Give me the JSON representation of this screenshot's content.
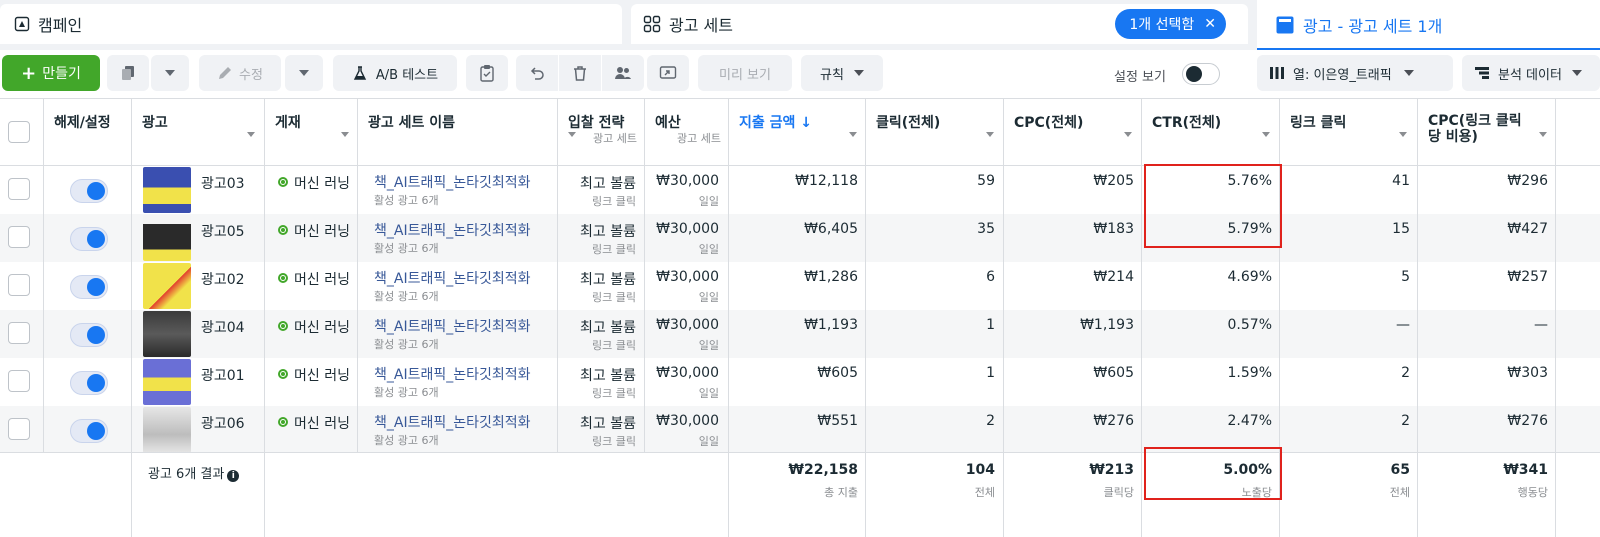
{
  "tabs": {
    "campaign": "캠페인",
    "adset": "광고 세트",
    "selected_chip": "1개 선택함",
    "ads": "광고 - 광고 세트 1개"
  },
  "toolbar": {
    "create": "만들기",
    "edit": "수정",
    "ab_test": "A/B 테스트",
    "preview": "미리 보기",
    "rules": "규칙",
    "view_settings": "설정 보기",
    "columns": "열: 이은영_트래픽",
    "breakdown": "분석 데이터"
  },
  "columns": {
    "toggle": "해제/설정",
    "ad": "광고",
    "delivery": "게재",
    "adset_name": "광고 세트 이름",
    "bid": "입찰 전략",
    "bid_sub": "광고 세트",
    "budget": "예산",
    "budget_sub": "광고 세트",
    "spend": "지출 금액 ↓",
    "clicks": "클릭(전체)",
    "cpc": "CPC(전체)",
    "ctr": "CTR(전체)",
    "link_clicks": "링크 클릭",
    "cpc_link": "CPC(링크 클릭 당 비용)"
  },
  "rows": [
    {
      "name": "광고03",
      "status": "머신 러닝",
      "adset": "책_AI트래픽_논타깃최적화",
      "adset_sub": "활성 광고 6개",
      "bid": "최고 볼륨",
      "bid_sub": "링크 클릭",
      "budget": "₩30,000",
      "budget_sub": "일일",
      "spend": "₩12,118",
      "clicks": "59",
      "cpc": "₩205",
      "ctr": "5.76%",
      "link_clicks": "41",
      "cpc_link": "₩296"
    },
    {
      "name": "광고05",
      "status": "머신 러닝",
      "adset": "책_AI트래픽_논타깃최적화",
      "adset_sub": "활성 광고 6개",
      "bid": "최고 볼륨",
      "bid_sub": "링크 클릭",
      "budget": "₩30,000",
      "budget_sub": "일일",
      "spend": "₩6,405",
      "clicks": "35",
      "cpc": "₩183",
      "ctr": "5.79%",
      "link_clicks": "15",
      "cpc_link": "₩427"
    },
    {
      "name": "광고02",
      "status": "머신 러닝",
      "adset": "책_AI트래픽_논타깃최적화",
      "adset_sub": "활성 광고 6개",
      "bid": "최고 볼륨",
      "bid_sub": "링크 클릭",
      "budget": "₩30,000",
      "budget_sub": "일일",
      "spend": "₩1,286",
      "clicks": "6",
      "cpc": "₩214",
      "ctr": "4.69%",
      "link_clicks": "5",
      "cpc_link": "₩257"
    },
    {
      "name": "광고04",
      "status": "머신 러닝",
      "adset": "책_AI트래픽_논타깃최적화",
      "adset_sub": "활성 광고 6개",
      "bid": "최고 볼륨",
      "bid_sub": "링크 클릭",
      "budget": "₩30,000",
      "budget_sub": "일일",
      "spend": "₩1,193",
      "clicks": "1",
      "cpc": "₩1,193",
      "ctr": "0.57%",
      "link_clicks": "—",
      "cpc_link": "—"
    },
    {
      "name": "광고01",
      "status": "머신 러닝",
      "adset": "책_AI트래픽_논타깃최적화",
      "adset_sub": "활성 광고 6개",
      "bid": "최고 볼륨",
      "bid_sub": "링크 클릭",
      "budget": "₩30,000",
      "budget_sub": "일일",
      "spend": "₩605",
      "clicks": "1",
      "cpc": "₩605",
      "ctr": "1.59%",
      "link_clicks": "2",
      "cpc_link": "₩303"
    },
    {
      "name": "광고06",
      "status": "머신 러닝",
      "adset": "책_AI트래픽_논타깃최적화",
      "adset_sub": "활성 광고 6개",
      "bid": "최고 볼륨",
      "bid_sub": "링크 클릭",
      "budget": "₩30,000",
      "budget_sub": "일일",
      "spend": "₩551",
      "clicks": "2",
      "cpc": "₩276",
      "ctr": "2.47%",
      "link_clicks": "2",
      "cpc_link": "₩276"
    }
  ],
  "summary": {
    "label": "광고 6개 결과",
    "spend": "₩22,158",
    "spend_sub": "총 지출",
    "clicks": "104",
    "clicks_sub": "전체",
    "cpc": "₩213",
    "cpc_sub": "클릭당",
    "ctr": "5.00%",
    "ctr_sub": "노출당",
    "link_clicks": "65",
    "link_clicks_sub": "전체",
    "cpc_link": "₩341",
    "cpc_link_sub": "행동당"
  },
  "colors": {
    "accent": "#1877f2",
    "create": "#42a72a",
    "highlight": "#e0221c"
  }
}
